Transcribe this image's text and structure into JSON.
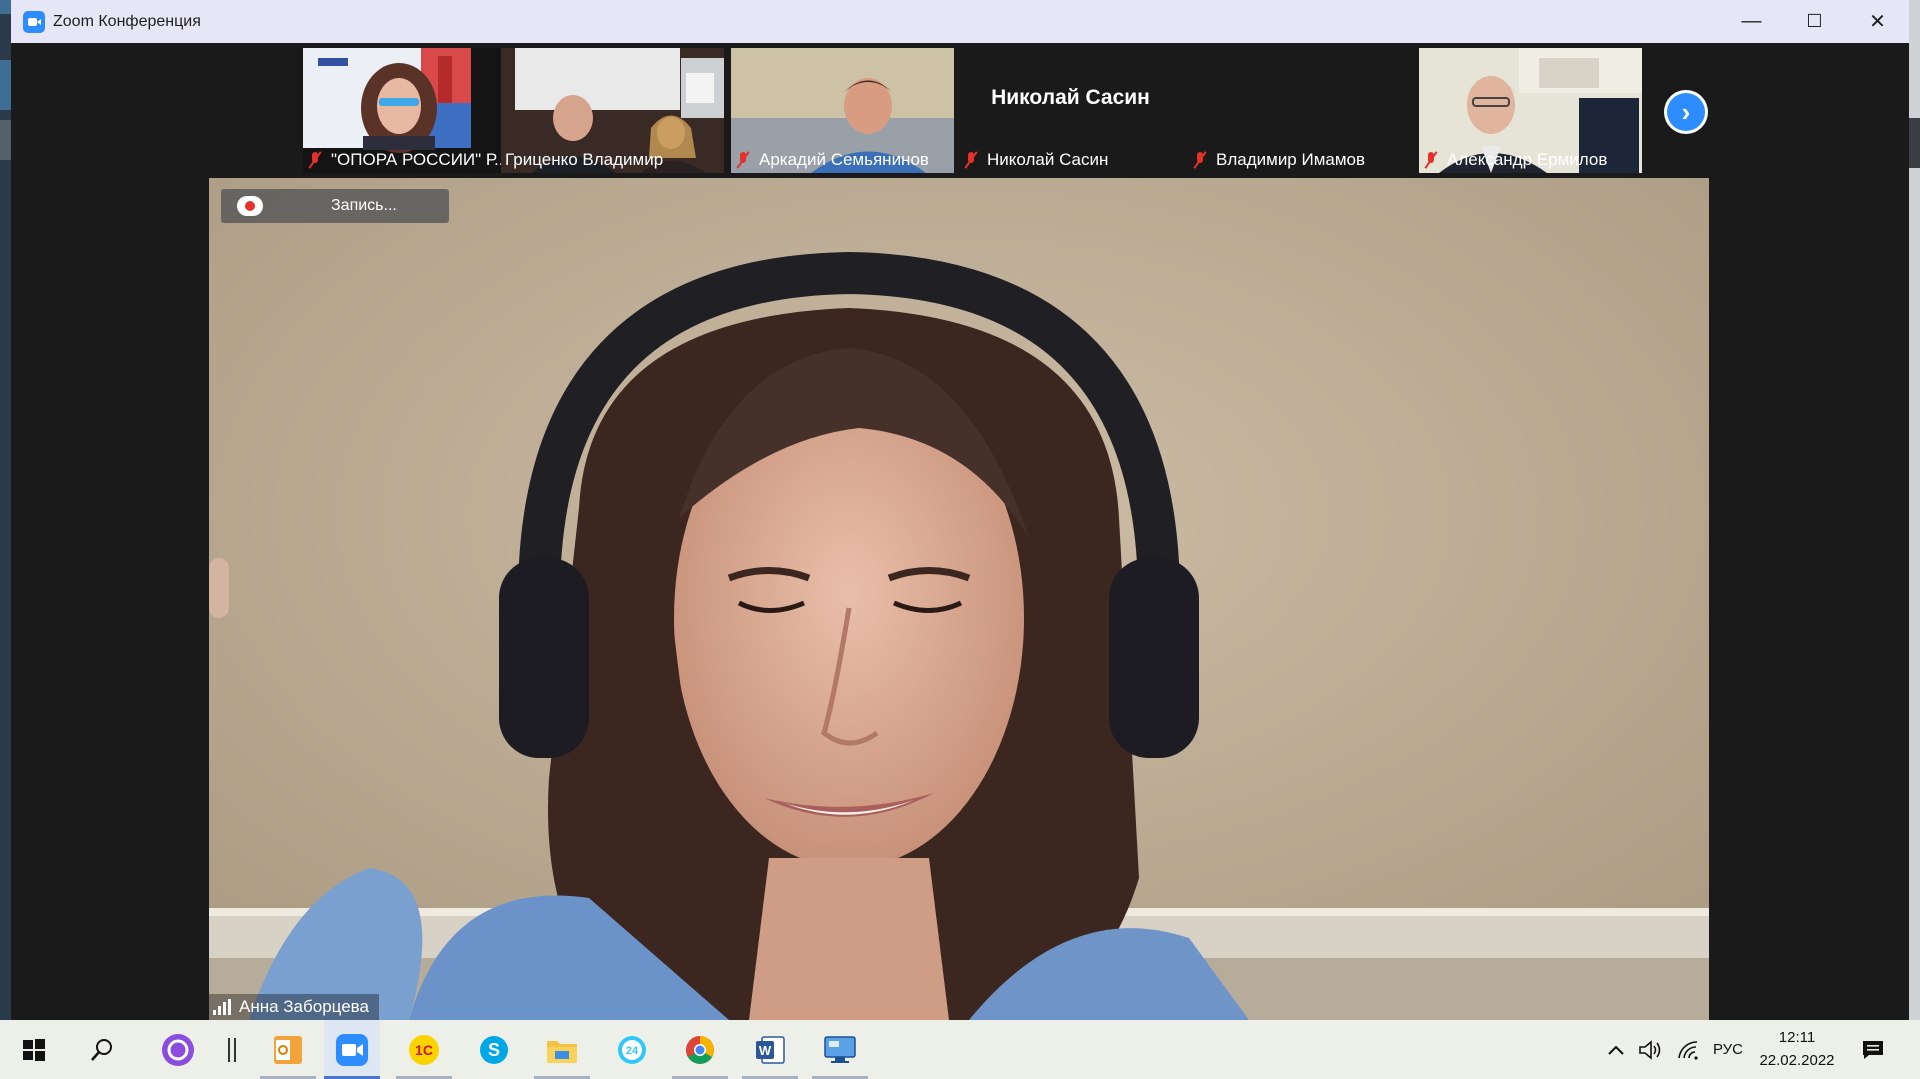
{
  "window": {
    "title": "Zoom Конференция",
    "minimize": "—",
    "maximize": "☐",
    "close": "✕"
  },
  "thumbnails": [
    {
      "name": "\"ОПОРА РОССИИ\" Р...",
      "muted": true,
      "video": true
    },
    {
      "name": "Гриценко Владимир",
      "muted": false,
      "video": true
    },
    {
      "name": "Аркадий Семьянинов",
      "muted": true,
      "video": true
    },
    {
      "name": "Николай Сасин",
      "display_name": "Николай Сасин",
      "muted": true,
      "video": false
    },
    {
      "name": "Владимир Имамов",
      "muted": true,
      "video": false
    },
    {
      "name": "Александр Ермилов",
      "muted": true,
      "video": true
    }
  ],
  "next_page": "›",
  "recording": {
    "label": "Запись..."
  },
  "speaker": {
    "name": "Анна Заборцева"
  },
  "taskbar": {
    "apps": [
      "start-icon",
      "search-icon",
      "alice-icon",
      "separator",
      "outlook-icon",
      "zoom-icon",
      "1c-icon",
      "skype-icon",
      "explorer-icon",
      "bitrix24-icon",
      "chrome-icon",
      "word-icon",
      "remote-desktop-icon"
    ],
    "alice_label": "",
    "onec_label": "1С",
    "skype_label": "S",
    "bitrix_label": "24",
    "word_label": "W",
    "language": "РУС",
    "time": "12:11",
    "date": "22.02.2022"
  },
  "colors": {
    "accent": "#2d8cff",
    "muted": "#e5302b",
    "taskbar": "#ecf0e8",
    "titlebar": "#e7e6f6"
  }
}
